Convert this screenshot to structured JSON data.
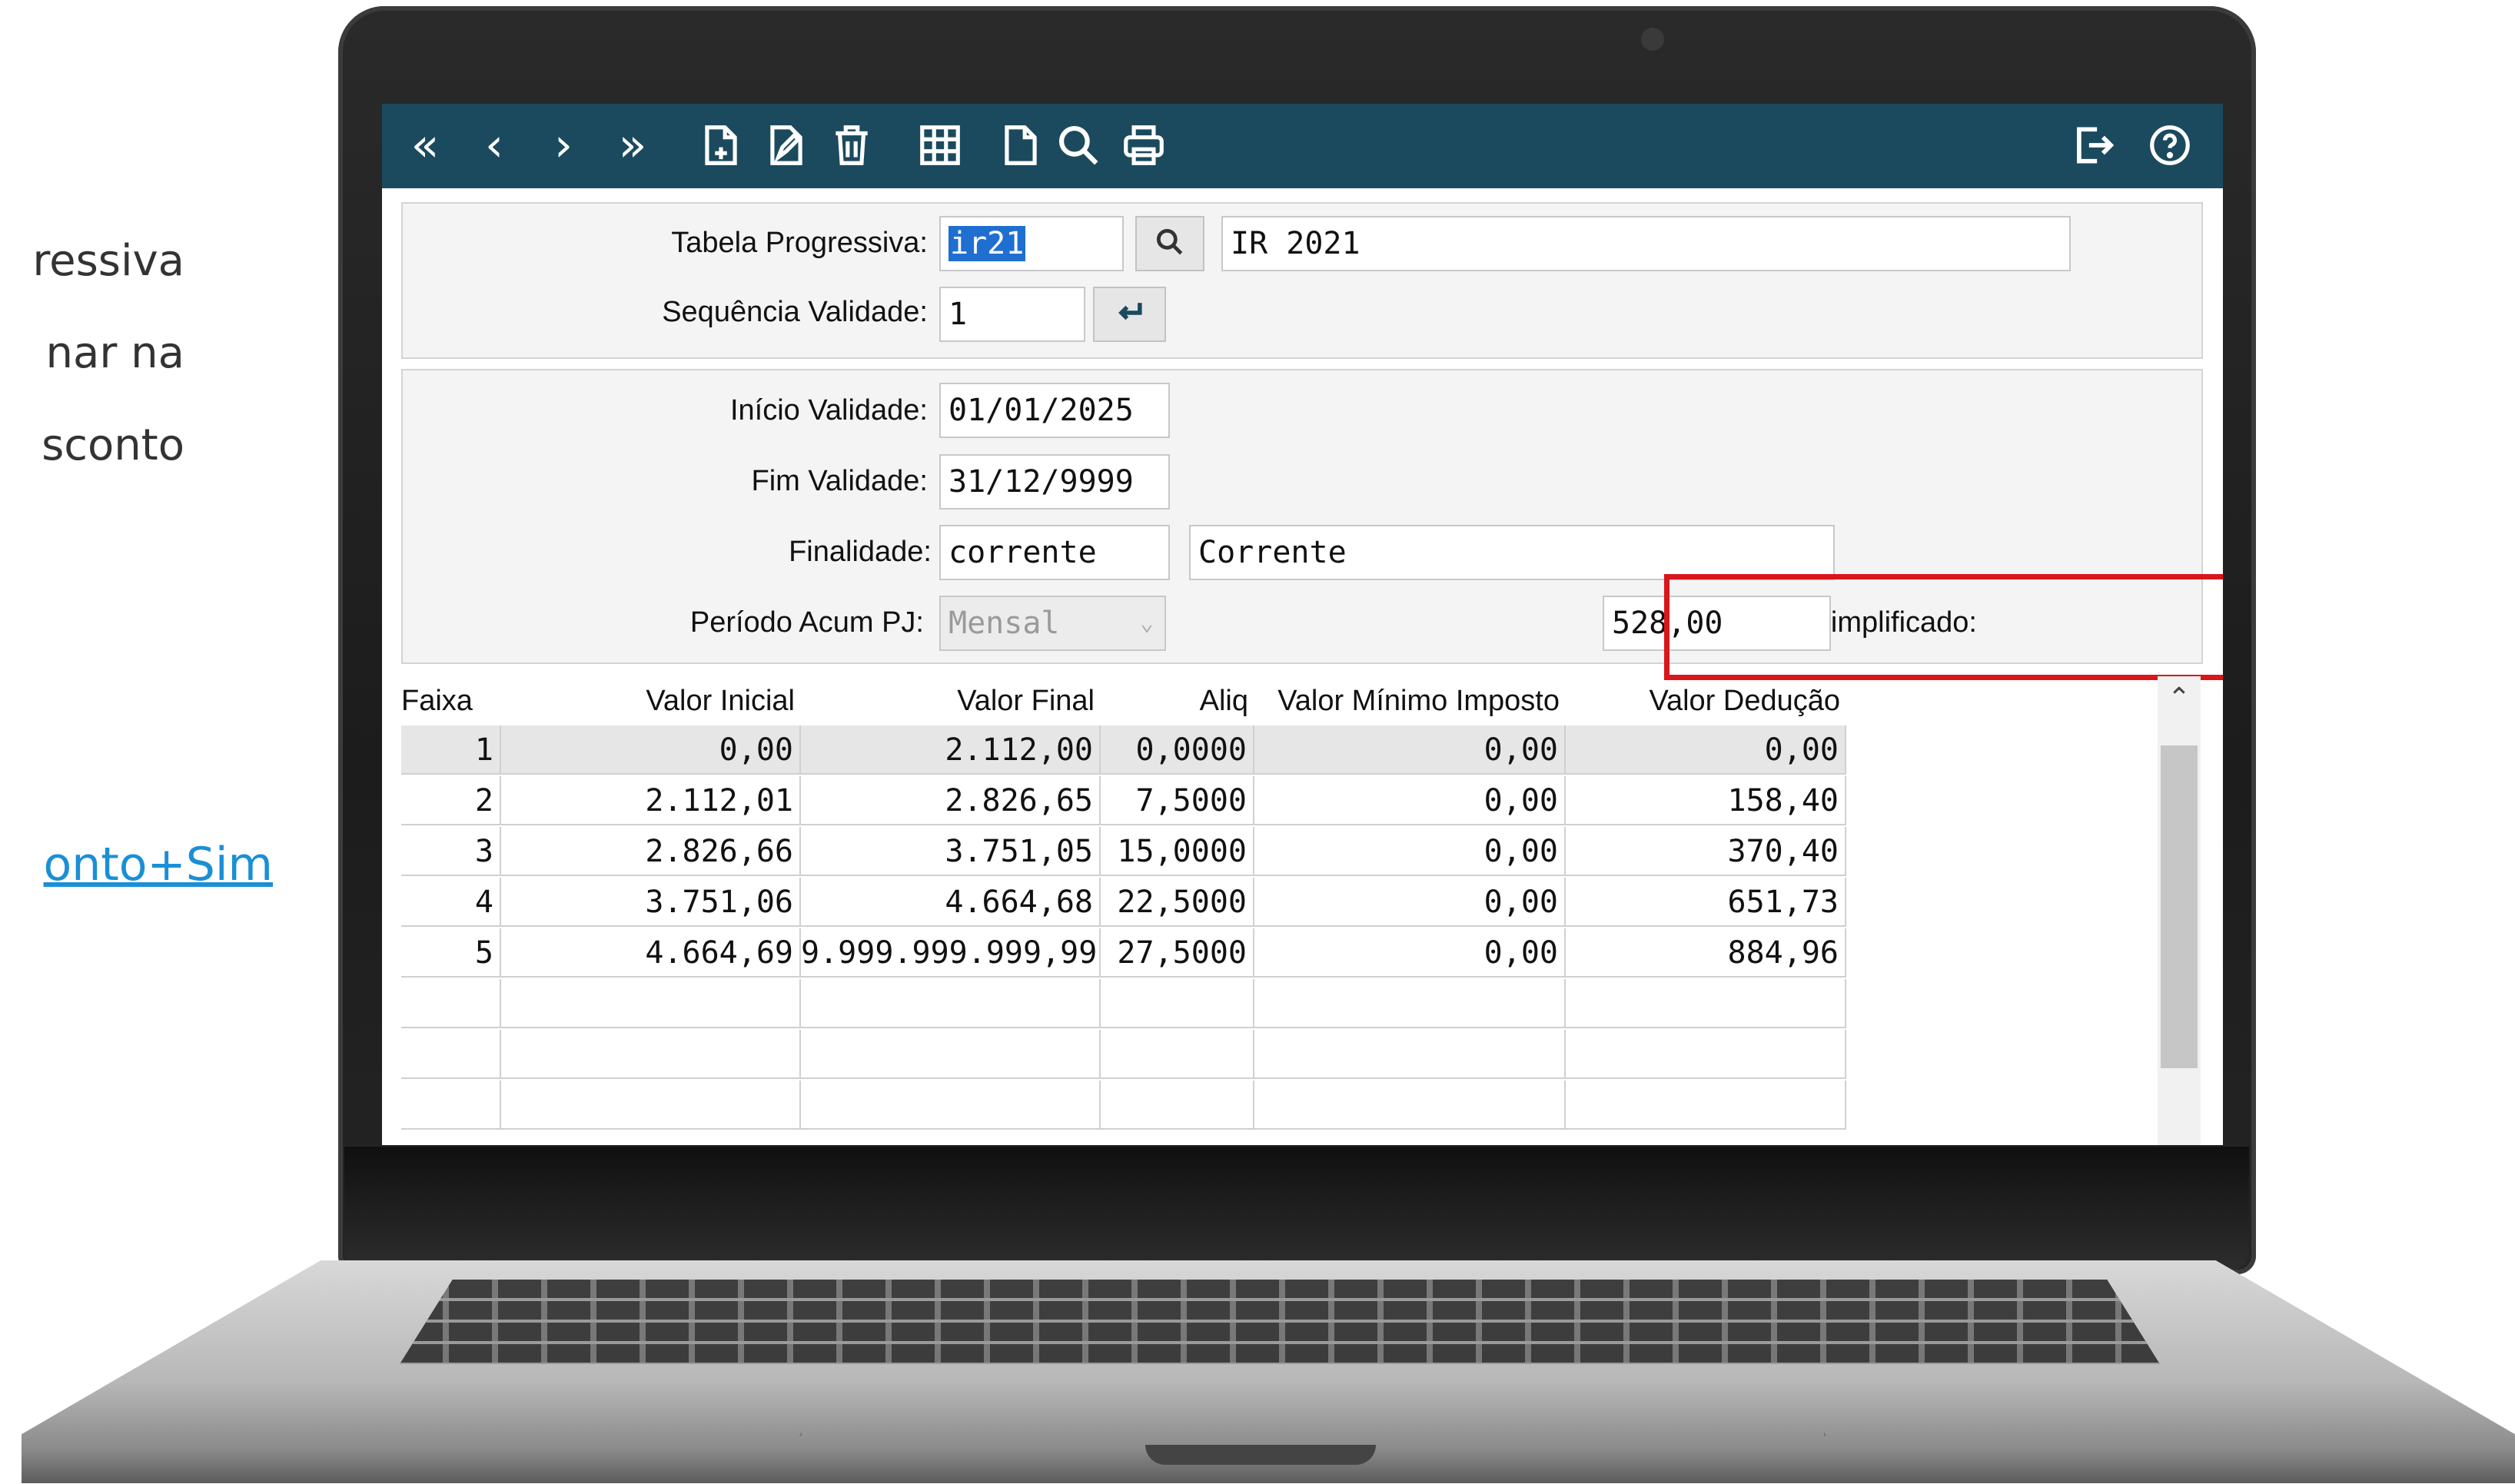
{
  "slide": {
    "text_lines": [
      "ressiva",
      "nar  na",
      "sconto"
    ],
    "link_text": "onto+Sim"
  },
  "toolbar": {
    "left_icons": [
      "first-icon",
      "previous-icon",
      "next-icon",
      "last-icon",
      "new-record-icon",
      "edit-record-icon",
      "delete-icon",
      "grid-icon",
      "blank-document-icon",
      "search-icon",
      "print-icon"
    ],
    "right_icons": [
      "exit-icon",
      "help-icon"
    ],
    "color": "#1b4a5e"
  },
  "form": {
    "tabela_label": "Tabela Progressiva:",
    "tabela_value": "ir21",
    "tabela_desc": "IR 2021",
    "sequencia_label": "Sequência Validade:",
    "sequencia_value": "1",
    "inicio_label": "Início Validade:",
    "inicio_value": "01/01/2025",
    "fim_label": "Fim Validade:",
    "fim_value": "31/12/9999",
    "finalidade_label": "Finalidade:",
    "finalidade_value": "corrente",
    "finalidade_desc": "Corrente",
    "periodo_label": "Período Acum PJ:",
    "periodo_value": "Mensal",
    "desc_label": "Desc. Simplificado:",
    "desc_value": "528,00"
  },
  "grid": {
    "headers": [
      "Faixa",
      "Valor Inicial",
      "Valor Final",
      "Aliq",
      "Valor Mínimo Imposto",
      "Valor Dedução"
    ],
    "rows": [
      [
        "1",
        "0,00",
        "2.112,00",
        "0,0000",
        "0,00",
        "0,00"
      ],
      [
        "2",
        "2.112,01",
        "2.826,65",
        "7,5000",
        "0,00",
        "158,40"
      ],
      [
        "3",
        "2.826,66",
        "3.751,05",
        "15,0000",
        "0,00",
        "370,40"
      ],
      [
        "4",
        "3.751,06",
        "4.664,68",
        "22,5000",
        "0,00",
        "651,73"
      ],
      [
        "5",
        "4.664,69",
        "9.999.999.999,99",
        "27,5000",
        "0,00",
        "884,96"
      ],
      [
        "",
        "",
        "",
        "",
        "",
        ""
      ],
      [
        "",
        "",
        "",
        "",
        "",
        ""
      ],
      [
        "",
        "",
        "",
        "",
        "",
        ""
      ]
    ]
  },
  "highlight_color": "#d8161c"
}
